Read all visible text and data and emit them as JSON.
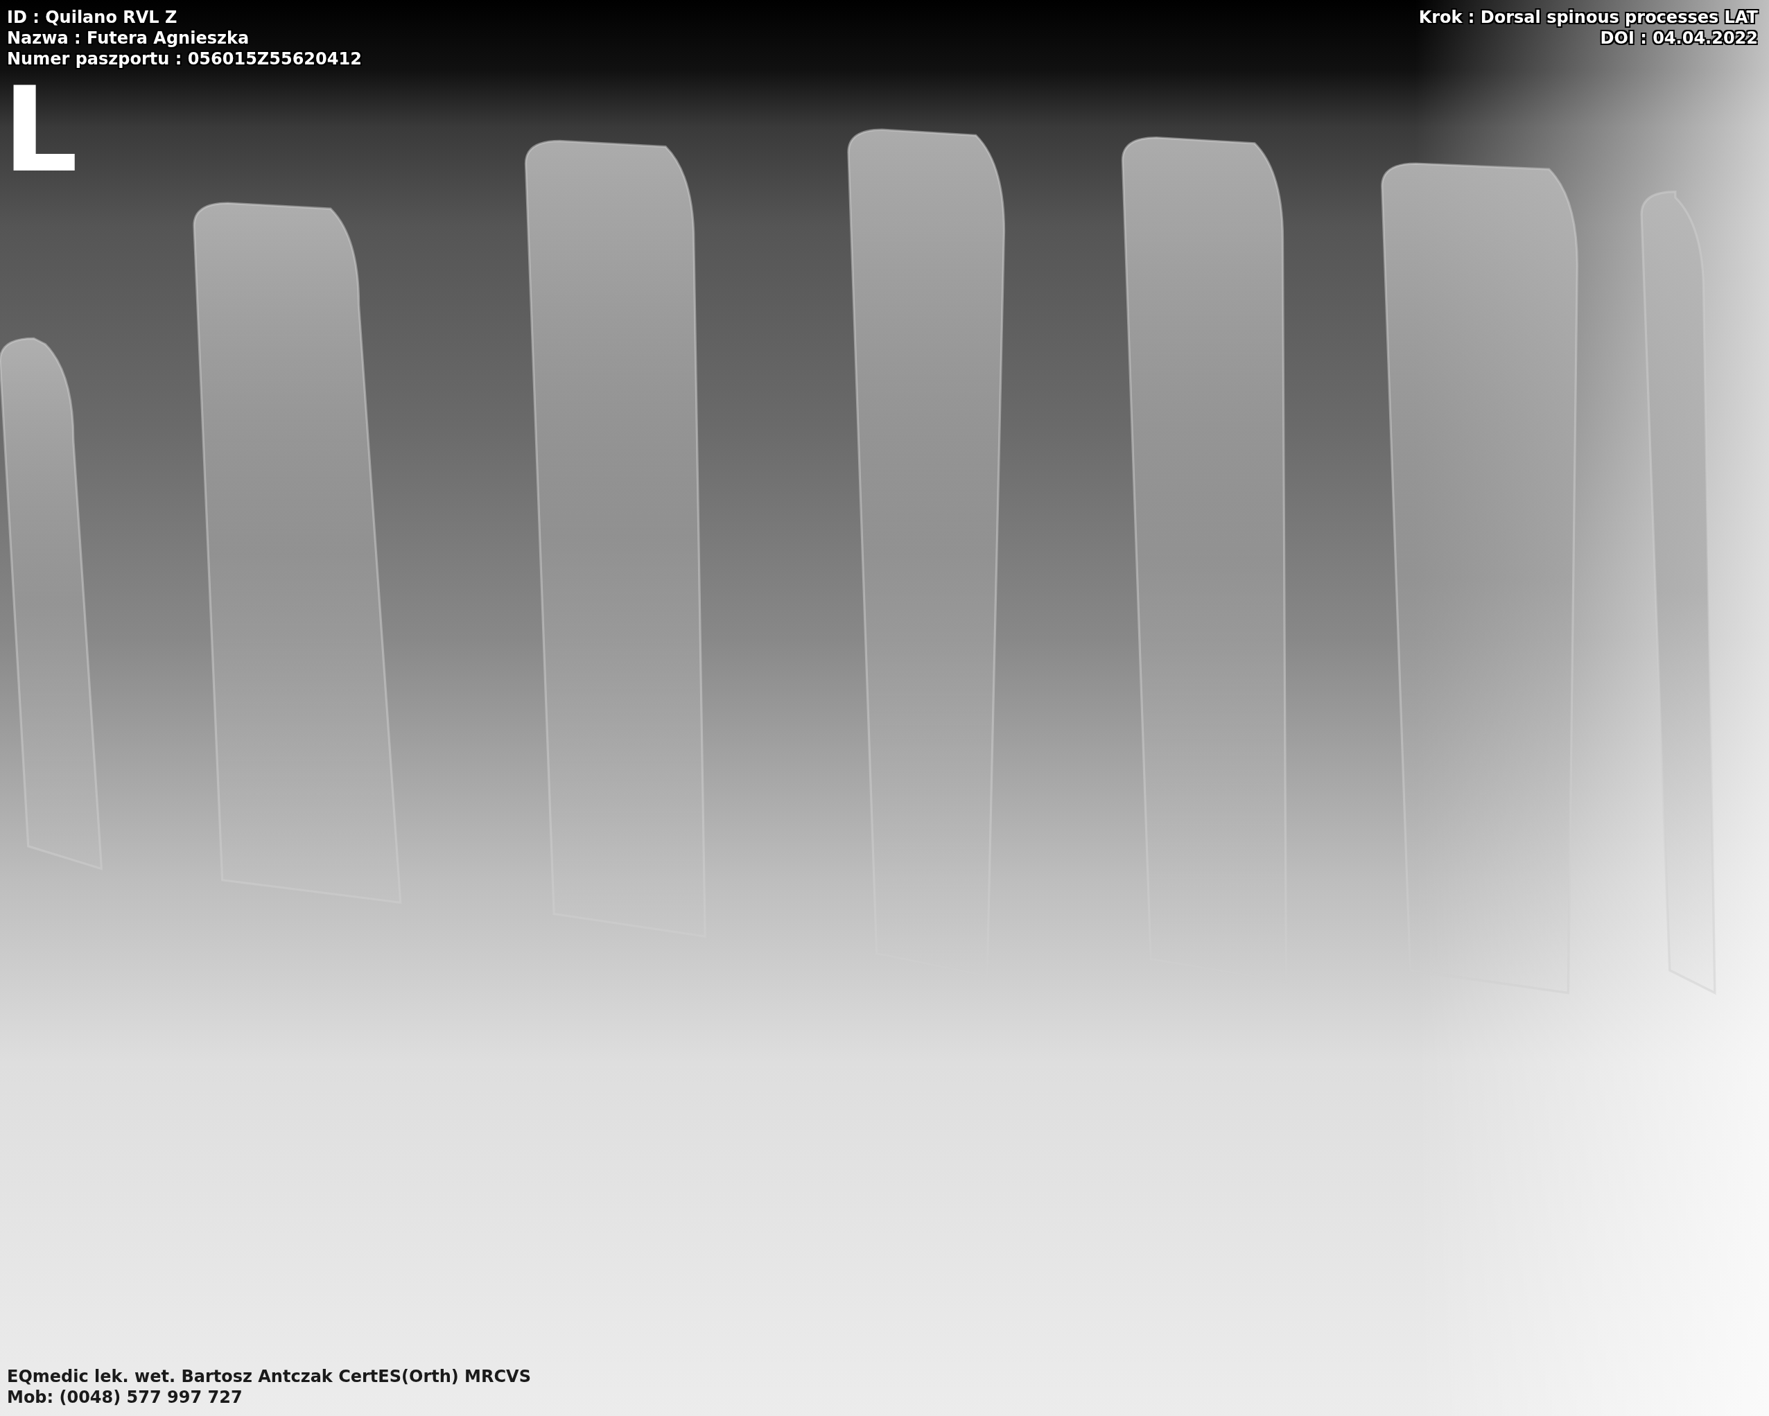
{
  "overlay_top_left": [
    "ID : Quilano RVL Z",
    "Nazwa : Futera Agnieszka",
    "Numer paszportu : 056015Z55620412"
  ],
  "overlay_top_right": [
    "Krok : Dorsal spinous processes LAT",
    "DOI : 04.04.2022"
  ],
  "orientation_marker": "L",
  "overlay_bottom_left": [
    "EQmedic lek. wet. Bartosz Antczak CertES(Orth) MRCVS",
    "Mob: (0048) 577 997 727"
  ]
}
